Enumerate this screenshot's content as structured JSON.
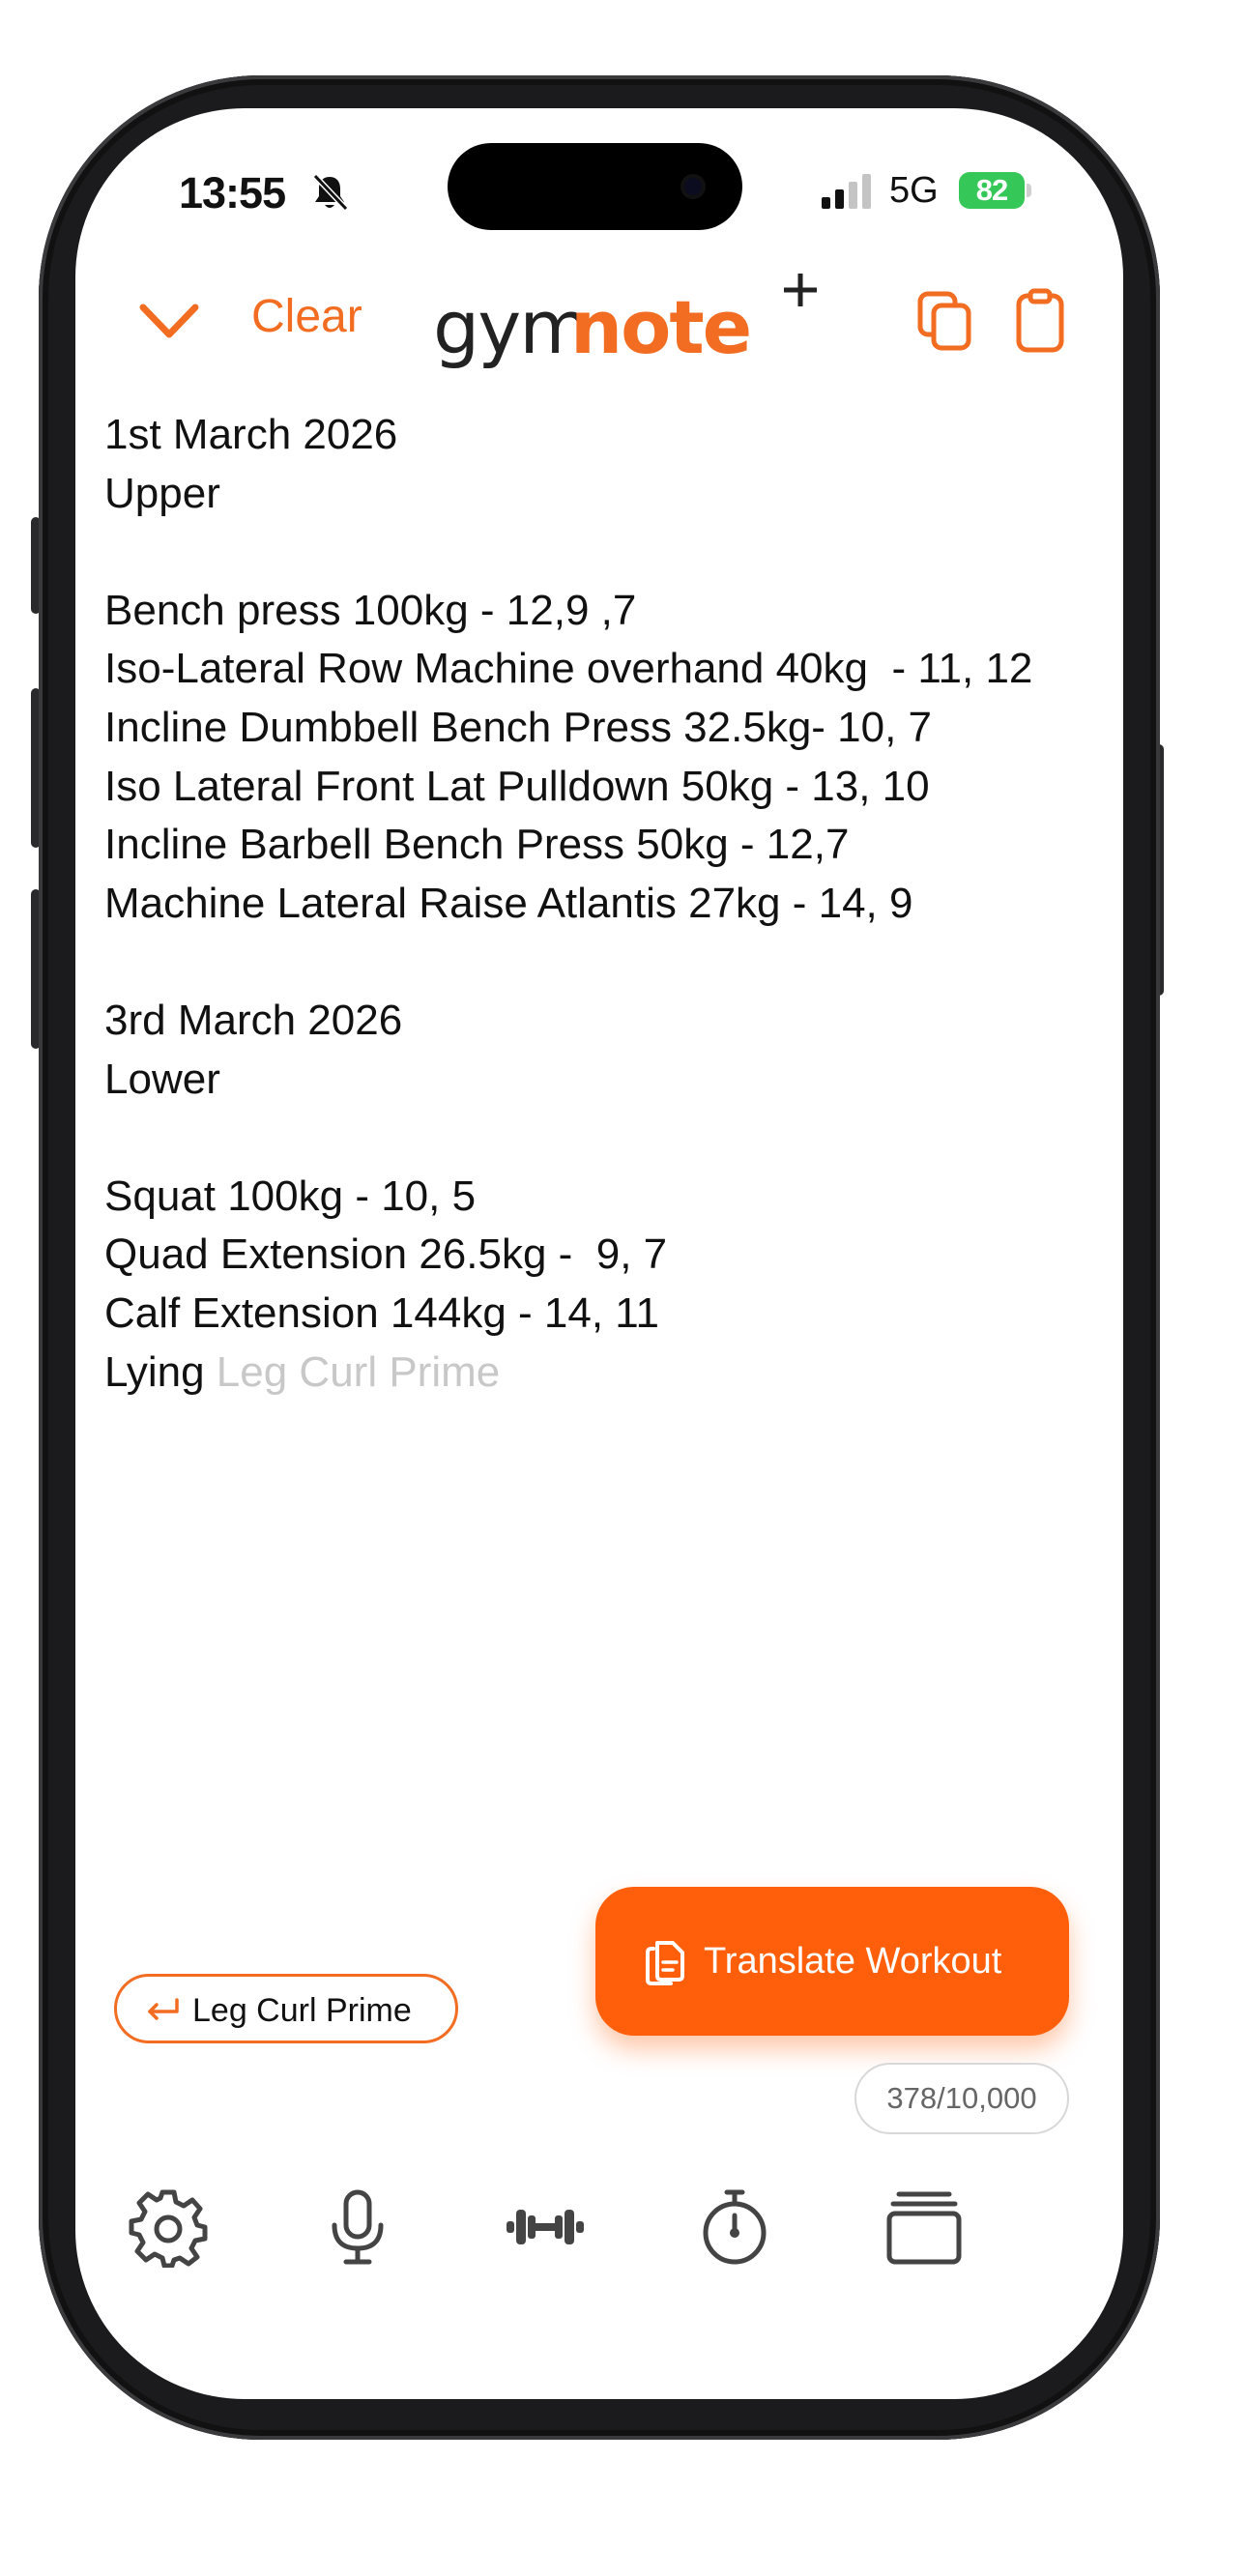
{
  "status_bar": {
    "time": "13:55",
    "network": "5G",
    "battery": "82"
  },
  "header": {
    "clear_label": "Clear",
    "logo_gym": "gym",
    "logo_note": "note",
    "icons": [
      "chevron-down-icon",
      "copy-icon",
      "clipboard-icon"
    ]
  },
  "note": {
    "lines": [
      "1st March 2026",
      "Upper",
      "",
      "Bench press 100kg - 12,9 ,7",
      "Iso-Lateral Row Machine overhand 40kg  - 11, 12",
      "Incline Dumbbell Bench Press 32.5kg- 10, 7",
      "Iso Lateral Front Lat Pulldown 50kg - 13, 10",
      "Incline Barbell Bench Press 50kg - 12,7",
      "Machine Lateral Raise Atlantis 27kg - 14, 9",
      "",
      "3rd March 2026",
      "Lower",
      "",
      "Squat 100kg - 10, 5",
      "Quad Extension 26.5kg -  9, 7",
      "Calf Extension 144kg - 14, 11"
    ],
    "current_line_typed": "Lying ",
    "current_line_suggestion": "Leg Curl Prime"
  },
  "suggestion_chip": {
    "label": "Leg Curl Prime"
  },
  "translate_button": {
    "label": "Translate Workout"
  },
  "char_counter": "378/10,000",
  "tab_bar": {
    "icons": [
      "gear-icon",
      "microphone-icon",
      "dumbbell-icon",
      "stopwatch-icon",
      "stack-icon"
    ]
  },
  "colors": {
    "accent": "#f26c21",
    "button": "#ff5f0a",
    "battery": "#36c759",
    "ghost_text": "#c8c8c8"
  }
}
